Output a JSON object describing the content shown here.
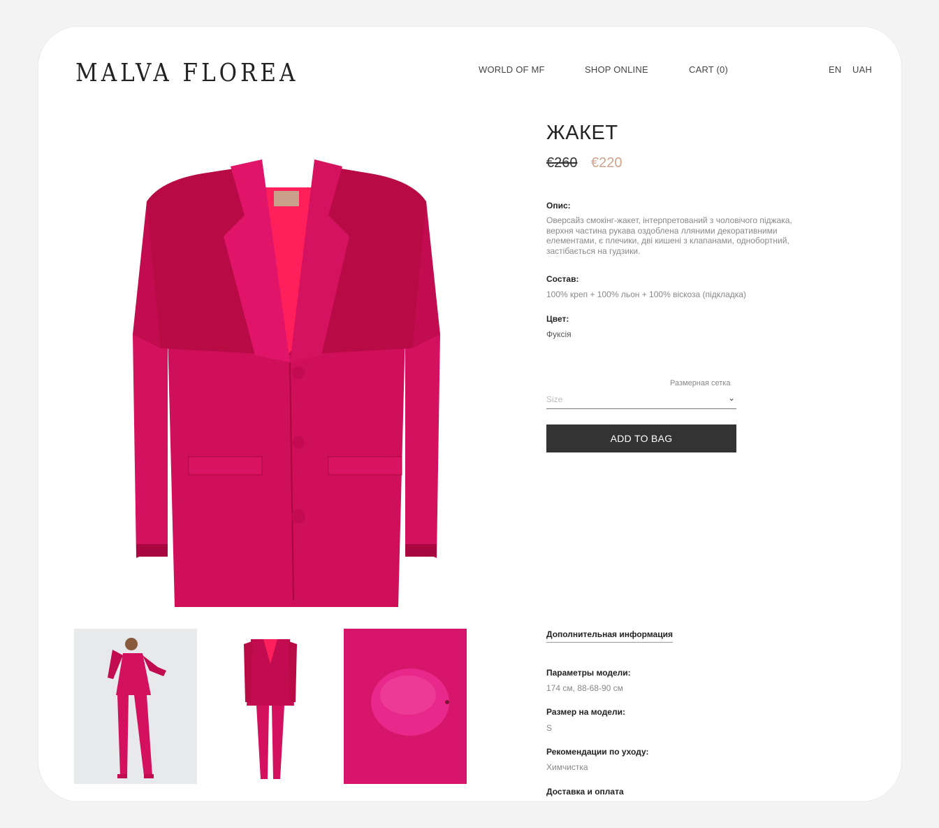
{
  "header": {
    "logo": "MALVA FLOREA",
    "nav": [
      "WORLD OF MF",
      "SHOP ONLINE",
      "CART (0)"
    ],
    "lang": "EN",
    "currency": "UAH"
  },
  "product": {
    "title": "ЖАКЕТ",
    "old_price": "€260",
    "price": "€220",
    "description_label": "Опис:",
    "description": "Оверсайз смокінг-жакет, інтерпретований з чоловічого піджака, верхня частина рукава оздоблена лляними декоративними елементами, є плечики,  дві кишені з клапанами, однобортний, застібається на гудзики.",
    "composition_label": "Состав:",
    "composition": "100% креп + 100% льон + 100% віскоза (підкладка)",
    "color_label": "Цвет:",
    "color": "Фуксія",
    "size_chart_link": "Размерная сетка",
    "size_placeholder": "Size",
    "add_to_bag": "ADD TO BAG"
  },
  "extra": {
    "tab_label": "Дополнительная информация",
    "model_params_label": "Параметры модели:",
    "model_params": "174 см, 88-68-90 см",
    "model_size_label": "Размер на модели:",
    "model_size": "S",
    "care_label": "Рекомендации по уходу:",
    "care": "Химчистка",
    "delivery_label": "Доставка и оплата"
  },
  "colors": {
    "fuchsia": "#d4115f",
    "fuchsia_dark": "#b80a45",
    "lining": "#ff1f5a",
    "sale_price": "#d0a28c",
    "button": "#333333"
  }
}
